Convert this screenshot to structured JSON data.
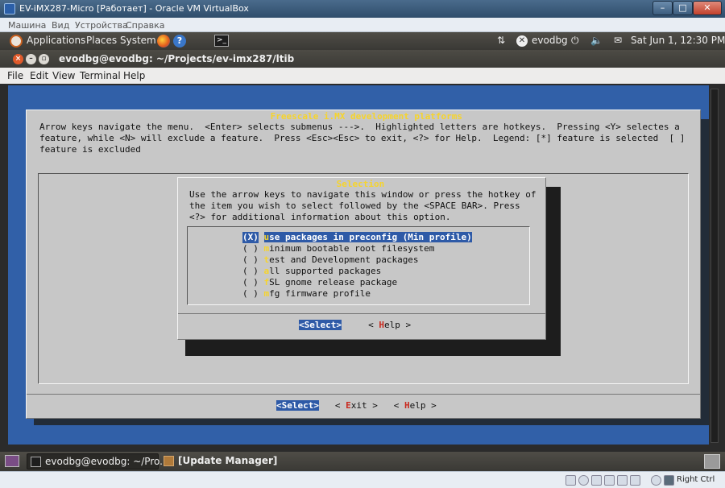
{
  "host_window": {
    "title": "EV-iMX287-Micro [Работает] - Oracle VM VirtualBox",
    "minimize": "–",
    "maximize": "□",
    "close": "✕"
  },
  "vbox_menu": [
    "Машина",
    "Вид",
    "Устройства",
    "Справка"
  ],
  "top_panel": {
    "menus": [
      "Applications",
      "Places",
      "System"
    ],
    "user": "evodbg",
    "clock": "Sat Jun  1, 12:30 PM"
  },
  "terminal": {
    "title": "evodbg@evodbg: ~/Projects/ev-imx287/ltib",
    "menu": [
      "File",
      "Edit",
      "View",
      "Terminal",
      "Help"
    ]
  },
  "menuconfig": {
    "title": " Freescale i.MX development platforms ",
    "legend": [
      "Arrow keys navigate the menu.  <Enter> selects submenus --->.  Highlighted letters are hotkeys.  Pressing <Y> selectes a",
      "feature, while <N> will exclude a feature.  Press <Esc><Esc> to exit, <?> for Help.  Legend: [*] feature is selected  [ ]",
      "feature is excluded"
    ],
    "buttons": {
      "select": "<Select>",
      "exit_pre": "< ",
      "exit_hk": "E",
      "exit_post": "xit >",
      "help_pre": "< ",
      "help_hk": "H",
      "help_post": "elp >"
    }
  },
  "selection_dialog": {
    "title": " Selection ",
    "help": [
      "Use the arrow keys to navigate this window or press the hotkey of",
      "the item you wish to select followed by the <SPACE BAR>. Press",
      "<?> for additional information about this option."
    ],
    "options": [
      {
        "mark": "(X)",
        "hotkey": "u",
        "rest": "se packages in preconfig (Min profile)"
      },
      {
        "mark": "( )",
        "hotkey": "m",
        "rest": "inimum bootable root filesystem"
      },
      {
        "mark": "( )",
        "hotkey": "t",
        "rest": "est and Development packages"
      },
      {
        "mark": "( )",
        "hotkey": "a",
        "rest": "ll supported packages"
      },
      {
        "mark": "( )",
        "hotkey": "f",
        "rest": "SL gnome release package"
      },
      {
        "mark": "( )",
        "hotkey": "m",
        "rest": "fg firmware profile"
      }
    ],
    "buttons": {
      "select": "<Select>",
      "help_pre": "< ",
      "help_hk": "H",
      "help_post": "elp >"
    }
  },
  "bottom_panel": {
    "tasks": [
      "evodbg@evodbg: ~/Pro...",
      "[Update Manager]"
    ]
  },
  "vbox_status": {
    "host_key": "Right Ctrl"
  },
  "colors": {
    "accent_blue": "#2e5aa7",
    "hotkey_yellow": "#f6d42c",
    "hotkey_red": "#c92a1f",
    "dialog_gray": "#c7c7c7",
    "terminal_blue": "#3160a8"
  }
}
